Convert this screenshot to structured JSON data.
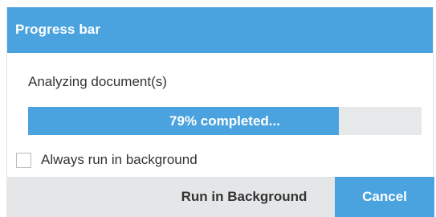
{
  "dialog": {
    "title": "Progress bar",
    "status_text": "Analyzing document(s)",
    "progress": {
      "percent": 79,
      "label": "79% completed..."
    },
    "checkbox": {
      "label": "Always run in background",
      "checked": false
    },
    "buttons": {
      "run_in_background": "Run in Background",
      "cancel": "Cancel"
    }
  },
  "colors": {
    "accent": "#4aa3df",
    "track": "#e6e8ea",
    "footer": "#e4e6e8"
  }
}
